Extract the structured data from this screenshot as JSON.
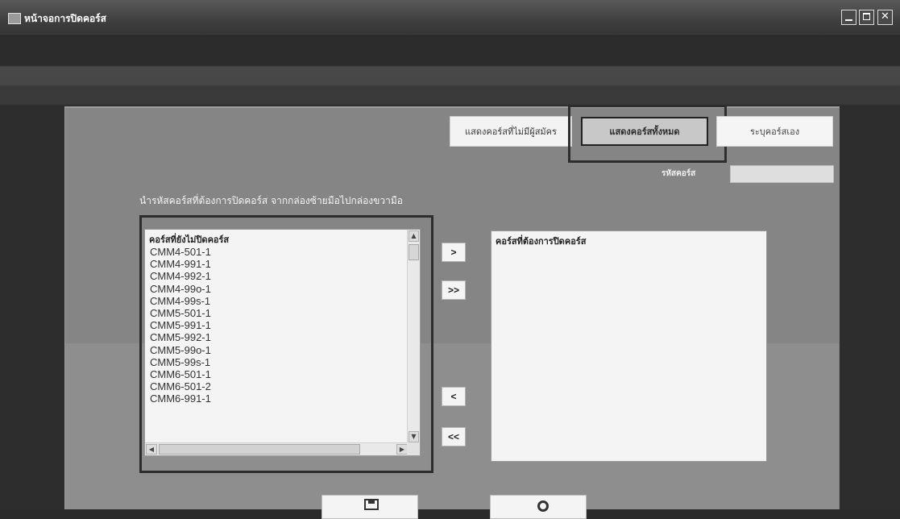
{
  "window": {
    "title": "หน้าจอการปิดคอร์ส"
  },
  "filter_tabs": {
    "unassigned": "แสดงคอร์สที่ไม่มีผู้สมัคร",
    "all": "แสดงคอร์สทั้งหมด",
    "custom": "ระบุคอร์สเอง"
  },
  "course_code": {
    "label": "รหัสคอร์ส",
    "value": ""
  },
  "instruction": "นำรหัสคอร์สที่ต้องการปิดคอร์ส จากกล่องซ้ายมือไปกล่องขวามือ",
  "left_list": {
    "header": "คอร์สที่ยังไม่ปิดคอร์ส",
    "items": [
      "CMM4-501-1",
      "CMM4-991-1",
      "CMM4-992-1",
      "CMM4-99o-1",
      "CMM4-99s-1",
      "CMM5-501-1",
      "CMM5-991-1",
      "CMM5-992-1",
      "CMM5-99o-1",
      "CMM5-99s-1",
      "CMM6-501-1",
      "CMM6-501-2",
      "CMM6-991-1"
    ]
  },
  "right_list": {
    "header": "คอร์สที่ต้องการปิดคอร์ส",
    "items": []
  },
  "move_buttons": {
    "add": ">",
    "add_all": ">>",
    "remove": "<",
    "remove_all": "<<"
  },
  "colors": {
    "panel": "#858585",
    "background": "#2c2c2c",
    "selected_tab": "#c8c8c8"
  }
}
